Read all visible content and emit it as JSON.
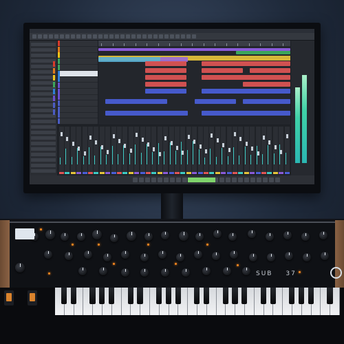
{
  "daw": {
    "tracks": [
      {
        "label": "",
        "color": "#d93a2b"
      },
      {
        "label": "",
        "color": "#e07a1c"
      },
      {
        "label": "",
        "color": "#f0c419"
      },
      {
        "label": "",
        "color": "#3ba55c"
      },
      {
        "label": "",
        "color": "#3ba55c"
      },
      {
        "label": "",
        "color": "#2f7fd8"
      },
      {
        "label": "",
        "color": "#2f7fd8"
      },
      {
        "label": "",
        "color": "#6a4fd1"
      },
      {
        "label": "",
        "color": "#6a4fd1"
      },
      {
        "label": "",
        "color": "#6a4fd1"
      },
      {
        "label": "",
        "color": "#4b5cc4"
      },
      {
        "label": "",
        "color": "#4b5cc4"
      },
      {
        "label": "",
        "color": "#4b5cc4"
      },
      {
        "label": "",
        "color": "#4b5cc4"
      }
    ],
    "accent_colors": {
      "red": "#e05555",
      "blue": "#4a5ed9",
      "yellow": "#e6c33a",
      "purple": "#8a5bd9",
      "teal": "#3ecbc4"
    }
  },
  "synth": {
    "model": "SUB",
    "model_number": "37"
  }
}
